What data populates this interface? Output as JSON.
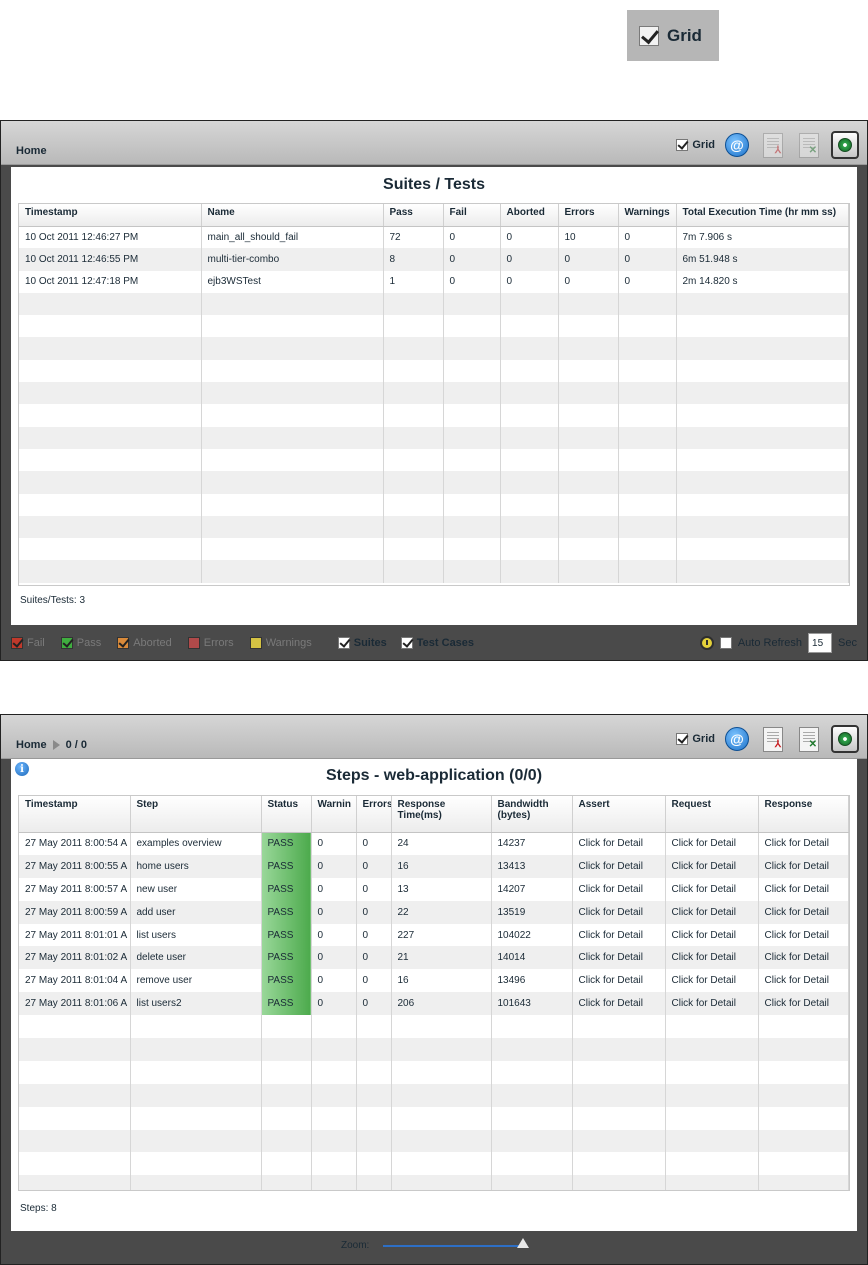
{
  "callout": {
    "grid_label": "Grid",
    "grid_checked": true
  },
  "suites": {
    "breadcrumb": {
      "home": "Home"
    },
    "toolbar": {
      "grid_label": "Grid"
    },
    "title": "Suites / Tests",
    "columns": [
      "Timestamp",
      "Name",
      "Pass",
      "Fail",
      "Aborted",
      "Errors",
      "Warnings",
      "Total Execution Time (hr mm ss)"
    ],
    "rows": [
      [
        "10 Oct 2011 12:46:27 PM",
        "main_all_should_fail",
        "72",
        "0",
        "0",
        "10",
        "0",
        "7m 7.906 s"
      ],
      [
        "10 Oct 2011 12:46:55 PM",
        "multi-tier-combo",
        "8",
        "0",
        "0",
        "0",
        "0",
        "6m 51.948 s"
      ],
      [
        "10 Oct 2011 12:47:18 PM",
        "ejb3WSTest",
        "1",
        "0",
        "0",
        "0",
        "0",
        "2m 14.820 s"
      ]
    ],
    "count_label": "Suites/Tests: 3",
    "legend": {
      "fail": "Fail",
      "pass": "Pass",
      "aborted": "Aborted",
      "errors": "Errors",
      "warnings": "Warnings",
      "suites": "Suites",
      "test_cases": "Test Cases",
      "colors": {
        "fail": "#c0392b",
        "pass": "#3fae3f",
        "aborted": "#d98a3a",
        "errors": "#b04a4a",
        "warnings": "#d4c243"
      }
    },
    "auto_refresh": {
      "label": "Auto Refresh",
      "value": "15",
      "unit": "Sec"
    }
  },
  "steps": {
    "breadcrumb": {
      "home": "Home",
      "current": "0 / 0"
    },
    "toolbar": {
      "grid_label": "Grid"
    },
    "title": "Steps - web-application (0/0)",
    "columns": [
      "Timestamp",
      "Step",
      "Status",
      "Warnin",
      "Errors",
      "Response Time(ms)",
      "Bandwidth (bytes)",
      "Assert",
      "Request",
      "Response"
    ],
    "rows": [
      [
        "27 May 2011 8:00:54 A",
        "examples overview",
        "PASS",
        "0",
        "0",
        "24",
        "14237",
        "Click for Detail",
        "Click for Detail",
        "Click for Detail"
      ],
      [
        "27 May 2011 8:00:55 A",
        "home users",
        "PASS",
        "0",
        "0",
        "16",
        "13413",
        "Click for Detail",
        "Click for Detail",
        "Click for Detail"
      ],
      [
        "27 May 2011 8:00:57 A",
        "new user",
        "PASS",
        "0",
        "0",
        "13",
        "14207",
        "Click for Detail",
        "Click for Detail",
        "Click for Detail"
      ],
      [
        "27 May 2011 8:00:59 A",
        "add user",
        "PASS",
        "0",
        "0",
        "22",
        "13519",
        "Click for Detail",
        "Click for Detail",
        "Click for Detail"
      ],
      [
        "27 May 2011 8:01:01 A",
        "list users",
        "PASS",
        "0",
        "0",
        "227",
        "104022",
        "Click for Detail",
        "Click for Detail",
        "Click for Detail"
      ],
      [
        "27 May 2011 8:01:02 A",
        "delete user",
        "PASS",
        "0",
        "0",
        "21",
        "14014",
        "Click for Detail",
        "Click for Detail",
        "Click for Detail"
      ],
      [
        "27 May 2011 8:01:04 A",
        "remove user",
        "PASS",
        "0",
        "0",
        "16",
        "13496",
        "Click for Detail",
        "Click for Detail",
        "Click for Detail"
      ],
      [
        "27 May 2011 8:01:06 A",
        "list users2",
        "PASS",
        "0",
        "0",
        "206",
        "101643",
        "Click for Detail",
        "Click for Detail",
        "Click for Detail"
      ]
    ],
    "count_label": "Steps: 8",
    "zoom": {
      "label": "Zoom:",
      "level": 1.0
    }
  }
}
